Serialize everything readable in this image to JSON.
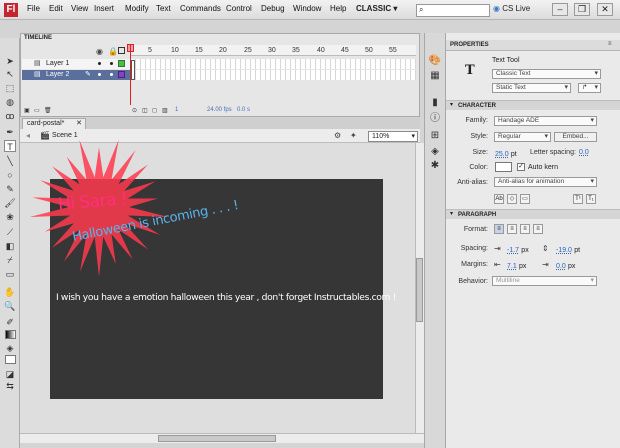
{
  "app": {
    "logo": "Fl"
  },
  "menu": [
    "File",
    "Edit",
    "View",
    "Insert",
    "Modify",
    "Text",
    "Commands",
    "Control",
    "Debug",
    "Window",
    "Help"
  ],
  "workspace": "CLASSIC",
  "search": {
    "placeholder": ""
  },
  "cs_live": "CS Live",
  "window_controls": {
    "minimize": "–",
    "restore": "❐",
    "close": "✕"
  },
  "timeline": {
    "tab": "TIMELINE",
    "frame_numbers": [
      "5",
      "10",
      "15",
      "20",
      "25",
      "30",
      "35",
      "40",
      "45",
      "50",
      "55"
    ],
    "layers": [
      {
        "name": "Layer 1"
      },
      {
        "name": "Layer 2"
      }
    ],
    "status": {
      "frame": "1",
      "fps": "24.00 fps",
      "time": "0.0 s"
    }
  },
  "document": {
    "tab": "card-postal*",
    "scene": "Scene 1",
    "zoom": "110%"
  },
  "stage": {
    "texts": {
      "hi": "Hi Sara !",
      "halloween": "Halloween is incoming . . . !",
      "wish": "I wish you have a emotion halloween this year , don't forget Instructables.com !"
    },
    "colors": {
      "stage_bg": "#363636",
      "burst": "#ff3a4e",
      "hi_text": "#ff2f7c",
      "halloween_text": "#58b4ec"
    }
  },
  "properties": {
    "header": "PROPERTIES",
    "tool_name": "Text Tool",
    "text_engine": "Classic Text",
    "text_type": "Static Text",
    "sections": {
      "character": "CHARACTER",
      "paragraph": "PARAGRAPH"
    },
    "character": {
      "family_label": "Family:",
      "family": "Handage ADE",
      "style_label": "Style:",
      "style": "Regular",
      "embed": "Embed...",
      "size_label": "Size:",
      "size": "25.0",
      "size_unit": "pt",
      "spacing_label": "Letter spacing:",
      "spacing": "0.0",
      "color_label": "Color:",
      "auto_kern": "Auto kern",
      "antialias_label": "Anti-alias:",
      "antialias": "Anti-alias for animation"
    },
    "paragraph": {
      "format_label": "Format:",
      "spacing_label": "Spacing:",
      "indent": "-1.7",
      "indent_unit": "px",
      "line_spacing": "-19.0",
      "line_unit": "pt",
      "margins_label": "Margins:",
      "margin_left": "7.1",
      "margin_left_unit": "px",
      "margin_right": "0.0",
      "margin_right_unit": "px",
      "behavior_label": "Behavior:",
      "behavior": "Multiline"
    }
  }
}
